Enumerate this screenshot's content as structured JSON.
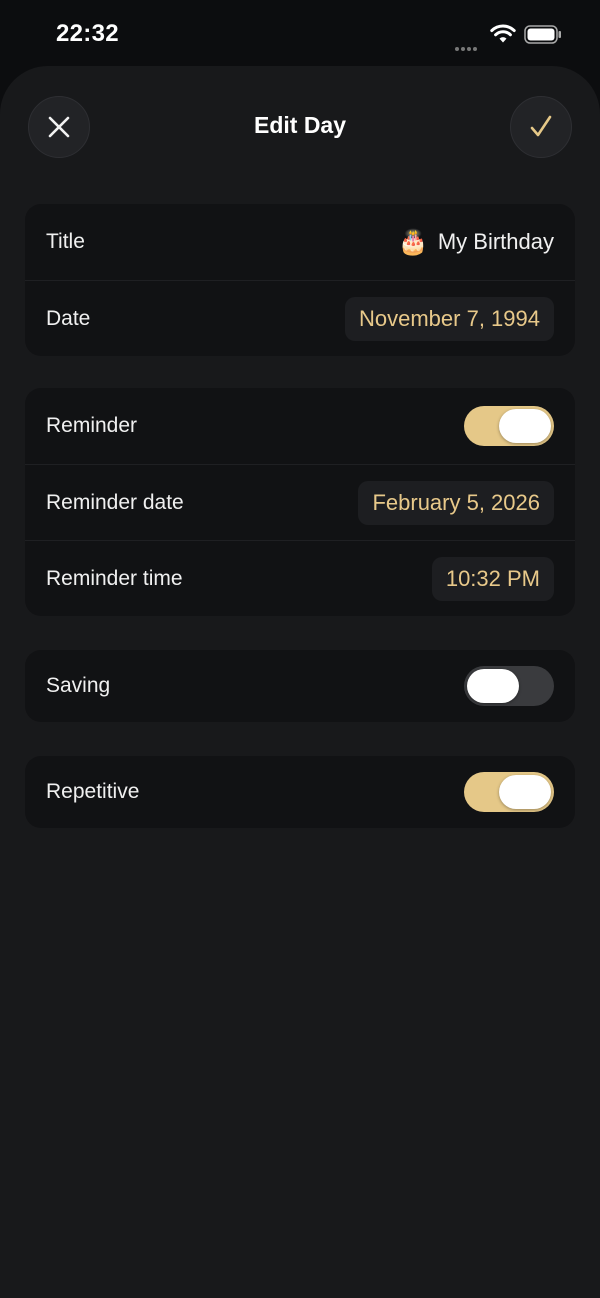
{
  "status_bar": {
    "time": "22:32"
  },
  "header": {
    "title": "Edit Day",
    "close_icon": "close-icon",
    "done_icon": "checkmark-icon"
  },
  "event_card": {
    "title_label": "Title",
    "title_emoji": "🎂",
    "title_value": "My Birthday",
    "date_label": "Date",
    "date_value": "November 7, 1994"
  },
  "reminder_card": {
    "reminder_label": "Reminder",
    "reminder_on": true,
    "reminder_date_label": "Reminder date",
    "reminder_date_value": "February 5, 2026",
    "reminder_time_label": "Reminder time",
    "reminder_time_value": "10:32 PM"
  },
  "saving_card": {
    "saving_label": "Saving",
    "saving_on": false
  },
  "repetitive_card": {
    "repetitive_label": "Repetitive",
    "repetitive_on": true
  },
  "colors": {
    "accent": "#e5c888",
    "background": "#18191b",
    "card": "#111214"
  }
}
